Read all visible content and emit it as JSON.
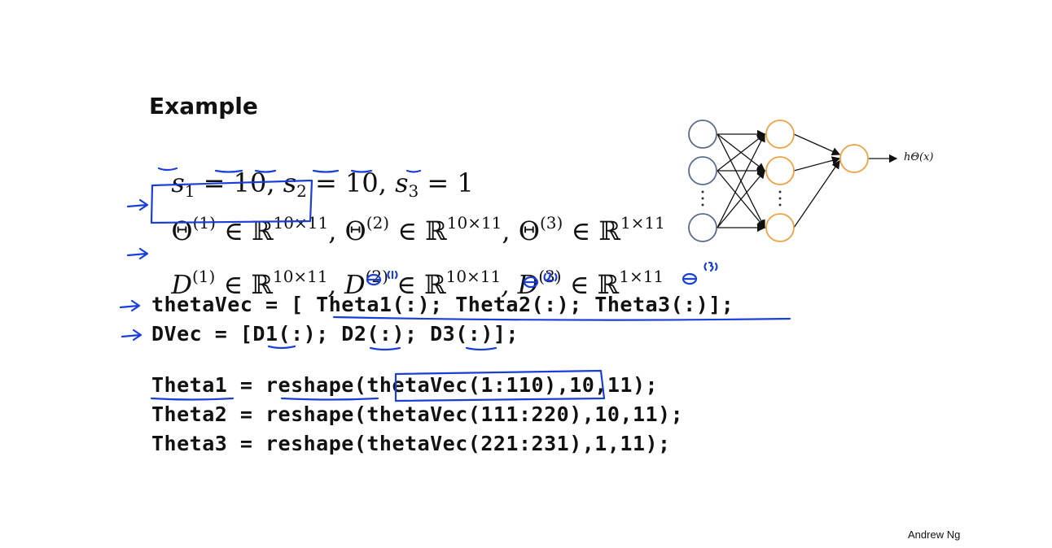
{
  "slide": {
    "title": "Example",
    "sizes_line": {
      "s1": "s",
      "s1_sub": "1",
      "v1": " = 10, ",
      "s2": "s",
      "s2_sub": "2",
      "v2": " = 10, ",
      "s3": "s",
      "s3_sub": "3",
      "v3": " = 1"
    },
    "theta_line": {
      "t1": "Θ",
      "t1_sup": "(1)",
      "t1_set": " ∈ ℝ",
      "t1_dim": "10×11",
      "t2": ", Θ",
      "t2_sup": "(2)",
      "t2_set": " ∈ ℝ",
      "t2_dim": "10×11",
      "t3": ", Θ",
      "t3_sup": "(3)",
      "t3_set": " ∈ ℝ",
      "t3_dim": "1×11"
    },
    "d_line": {
      "d1": "D",
      "d1_sup": "(1)",
      "d1_set": " ∈ ℝ",
      "d1_dim": "10×11",
      "d2": ", D",
      "d2_sup": "(2)",
      "d2_set": " ∈ ℝ",
      "d2_dim": "10×11",
      "d3": ", D",
      "d3_sup": "(3)",
      "d3_set": " ∈ ℝ",
      "d3_dim": "1×11"
    },
    "code": {
      "line1": "thetaVec = [ Theta1(:); Theta2(:); Theta3(:)];",
      "line2": "DVec = [D1(:); D2(:); D3(:)];",
      "line3": "Theta1 = reshape(thetaVec(1:110),10,11);",
      "line4": "Theta2 = reshape(thetaVec(111:220),10,11);",
      "line5": "Theta3 = reshape(thetaVec(221:231),1,11);"
    },
    "network": {
      "output_label": "hΘ(x)",
      "input_color": "#5a6b8c",
      "hidden_color": "#f0a040",
      "output_color": "#f0a040"
    },
    "annotation_color": "#1a3fd6",
    "credit": "Andrew Ng"
  }
}
